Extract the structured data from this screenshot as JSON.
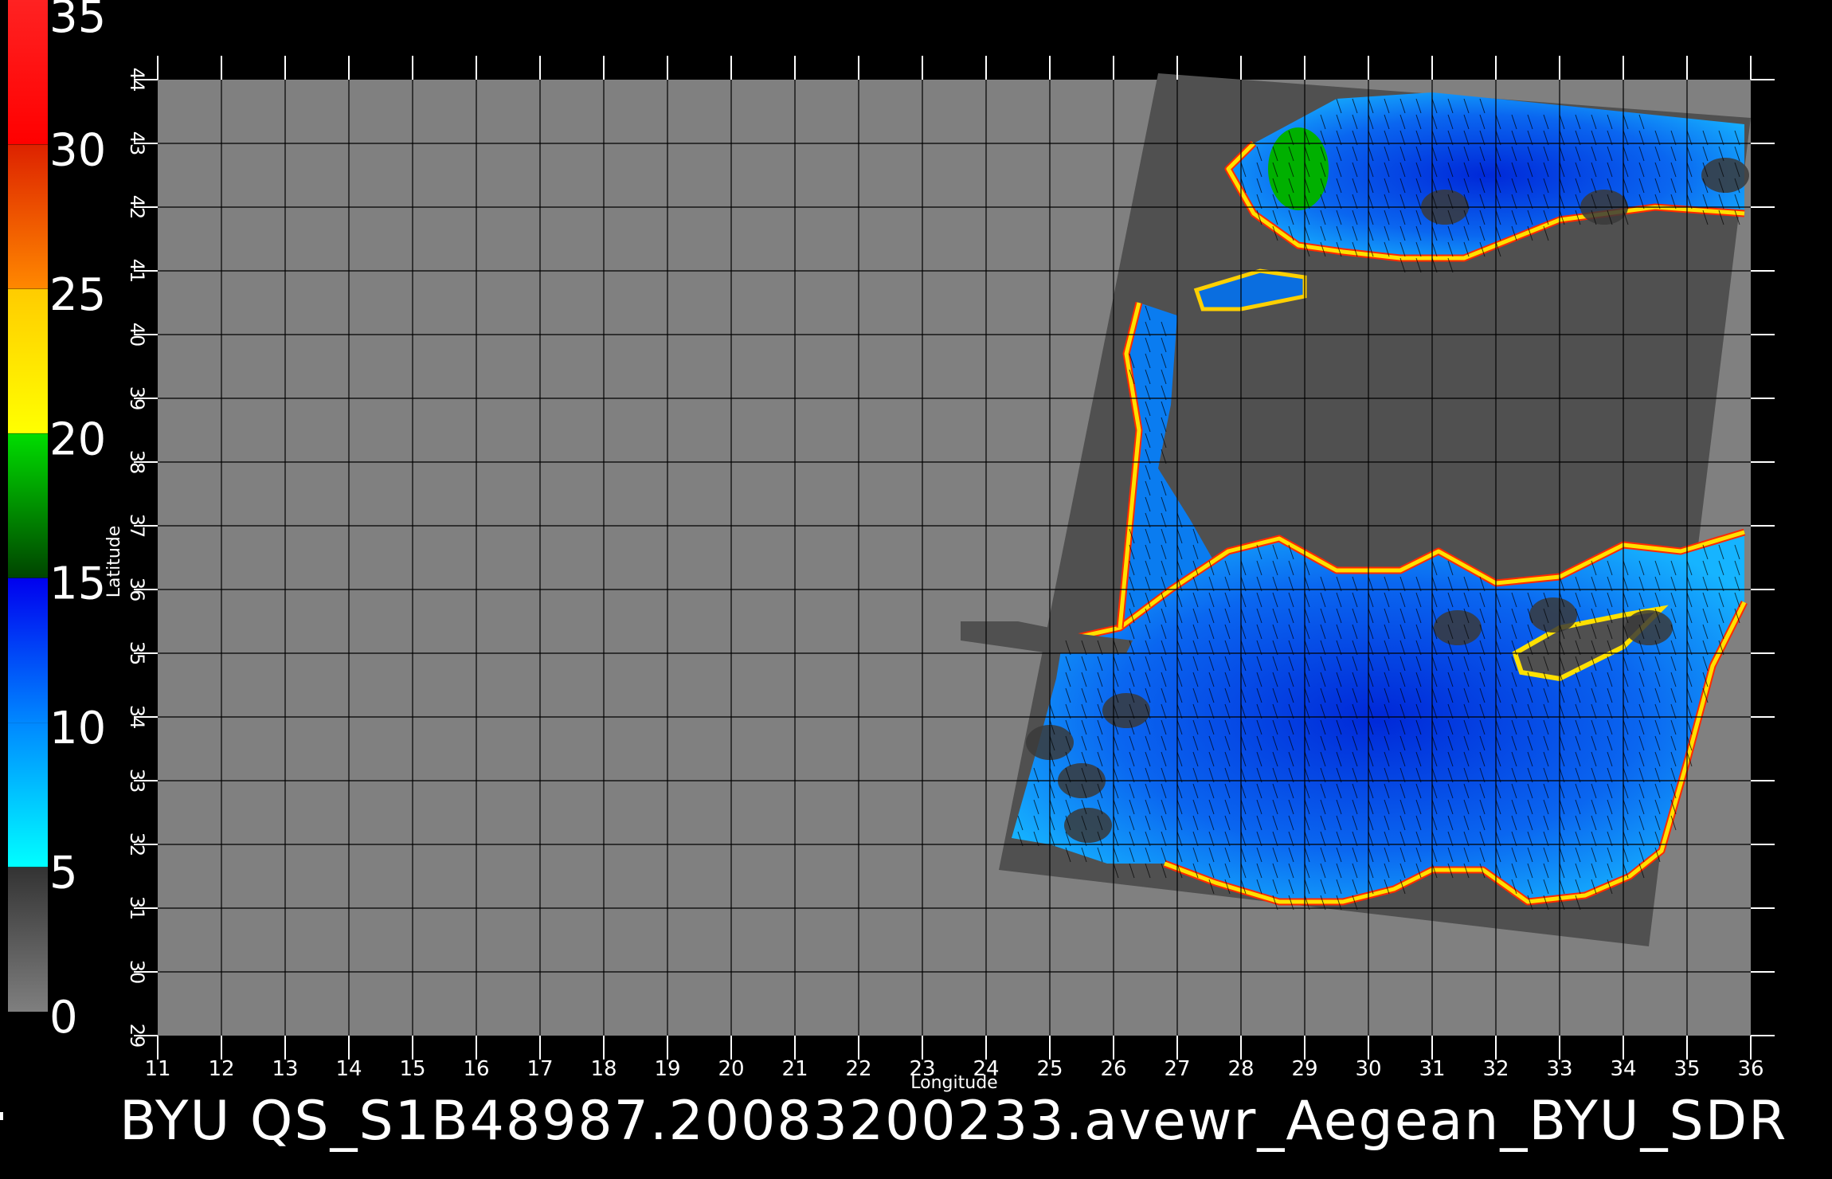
{
  "caption": "BYU  QS_S1B48987.20083200233.avewr_Aegean_BYU_SDR",
  "axes": {
    "xlabel": "Longitude",
    "ylabel": "Latitude",
    "lon_range": [
      11,
      36
    ],
    "lat_range": [
      29,
      44
    ],
    "lon_ticks": [
      "11",
      "12",
      "13",
      "14",
      "15",
      "16",
      "17",
      "18",
      "19",
      "20",
      "21",
      "22",
      "23",
      "24",
      "25",
      "26",
      "27",
      "28",
      "29",
      "30",
      "31",
      "32",
      "33",
      "34",
      "35",
      "36"
    ],
    "lat_ticks": [
      "29",
      "30",
      "31",
      "32",
      "33",
      "34",
      "35",
      "36",
      "37",
      "38",
      "39",
      "40",
      "41",
      "42",
      "43",
      "44"
    ],
    "grid": true
  },
  "colorbar": {
    "tick_labels": [
      "0",
      "5",
      "10",
      "15",
      "20",
      "25",
      "30",
      "35"
    ],
    "stops": [
      {
        "value": 0,
        "color": "#7f7f7f"
      },
      {
        "value": 5,
        "color": "#333333"
      },
      {
        "value": 5.01,
        "color": "#00ffff"
      },
      {
        "value": 10,
        "color": "#0088ff"
      },
      {
        "value": 15,
        "color": "#0000ee"
      },
      {
        "value": 15.01,
        "color": "#004400"
      },
      {
        "value": 20,
        "color": "#00dd00"
      },
      {
        "value": 20.01,
        "color": "#ffff00"
      },
      {
        "value": 25,
        "color": "#ffcc00"
      },
      {
        "value": 25.01,
        "color": "#ff8800"
      },
      {
        "value": 30,
        "color": "#dd2200"
      },
      {
        "value": 30.01,
        "color": "#ff0000"
      },
      {
        "value": 35,
        "color": "#ff2222"
      },
      {
        "value": 35.01,
        "color": "#cc8855"
      }
    ]
  },
  "colors": {
    "background": "#000000",
    "no_data": "#808080",
    "land": "#505050",
    "grid": "#000000"
  },
  "swath_corners_lonlat": [
    [
      26.7,
      44.1
    ],
    [
      36.0,
      43.4
    ],
    [
      34.4,
      30.4
    ],
    [
      24.2,
      31.6
    ]
  ]
}
